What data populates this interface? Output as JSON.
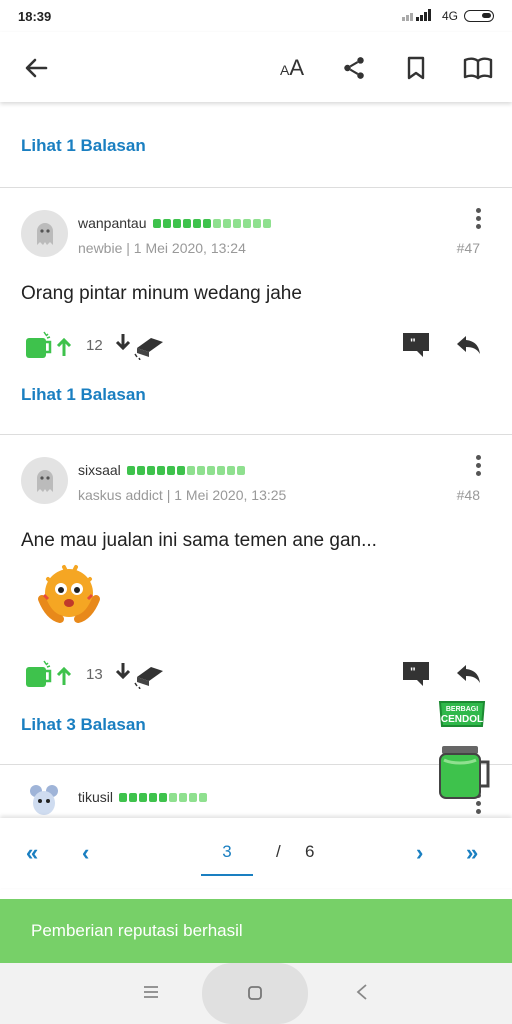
{
  "status_bar": {
    "time": "18:39",
    "network": "4G"
  },
  "header": {
    "font_size_icon": "text-size-icon"
  },
  "feed": {
    "top_reply_link": "Lihat 1 Balasan",
    "posts": [
      {
        "username": "wanpantau",
        "rank_bars_filled": 6,
        "rank_bars_total": 12,
        "meta": "newbie | 1 Mei 2020, 13:24",
        "post_number": "#47",
        "body": "Orang pintar minum wedang jahe",
        "cendol_count": "12",
        "reply_link": "Lihat 1 Balasan"
      },
      {
        "username": "sixsaal",
        "rank_bars_filled": 6,
        "rank_bars_total": 12,
        "meta": "kaskus addict | 1 Mei 2020, 13:25",
        "post_number": "#48",
        "body": "Ane mau jualan ini sama temen ane gan...",
        "cendol_count": "13",
        "reply_link": "Lihat 3 Balasan"
      },
      {
        "username": "tikusil",
        "rank_bars_filled": 5,
        "rank_bars_total": 9
      }
    ]
  },
  "pagination": {
    "current": "3",
    "separator": "/",
    "total": "6"
  },
  "toast": {
    "message": "Pemberian reputasi berhasil"
  },
  "cendol_badge": {
    "line1": "BERBAGI",
    "line2": "CENDOL"
  },
  "colors": {
    "accent": "#1a7fc1",
    "green": "#3ec24c",
    "toast": "#77d068"
  }
}
